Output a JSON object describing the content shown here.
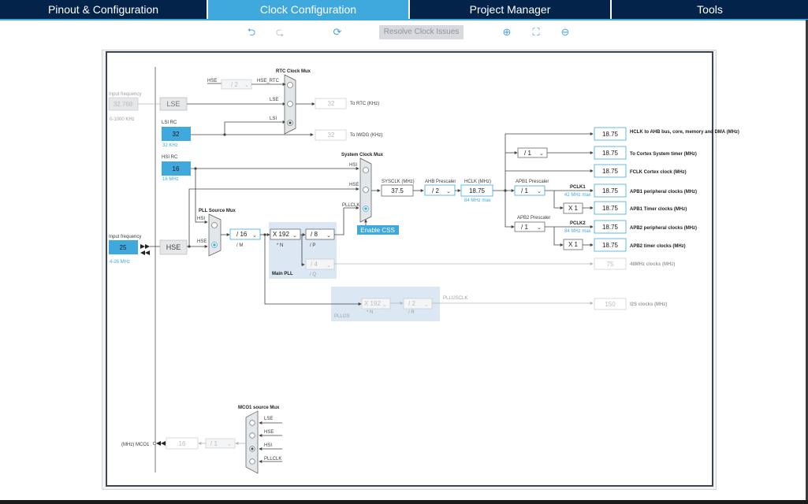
{
  "tabs": [
    {
      "label": "Pinout & Configuration",
      "active": false
    },
    {
      "label": "Clock Configuration",
      "active": true
    },
    {
      "label": "Project Manager",
      "active": false
    },
    {
      "label": "Tools",
      "active": false
    }
  ],
  "toolbar": {
    "undo_icon": "undo-icon",
    "redo_icon": "redo-icon",
    "reset_icon": "refresh-icon",
    "resolve_label": "Resolve Clock Issues",
    "zoom_in_icon": "zoom-in-icon",
    "fit_icon": "fit-screen-icon",
    "zoom_out_icon": "zoom-out-icon"
  },
  "colors": {
    "tab_bg": "#03234b",
    "tab_active": "#3fa9dd",
    "accent": "#3fa9dd"
  },
  "diagram": {
    "input_freq_lse_label": "Input frequency",
    "input_freq_lse": "32.768",
    "lse_range": "0-1000 KHz",
    "lse": "LSE",
    "lsi_rc": "LSI RC",
    "lsi_value": "32",
    "lsi_unit": "32 KHz",
    "hsi_rc": "HSI RC",
    "hsi_value": "16",
    "hsi_unit": "16 MHz",
    "input_freq_hse_label": "Input frequency",
    "input_freq_hse": "25",
    "hse_range": "4-26 MHz",
    "hse": "HSE",
    "rtc_mux_title": "RTC Clock Mux",
    "rtc_hse": "HSE",
    "rtc_div": "/ 2",
    "rtc_hse_rtc": "HSE_RTC",
    "rtc_lse": "LSE",
    "rtc_lsi": "LSI",
    "rtc_out": "32",
    "rtc_out_label": "To RTC (KHz)",
    "iwdg_out": "32",
    "iwdg_out_label": "To IWDG (KHz)",
    "sys_mux_title": "System Clock Mux",
    "sys_hsi": "HSI",
    "sys_hse": "HSE",
    "sys_pllclk": "PLLCLK",
    "enable_css": "Enable CSS",
    "sysclk_label": "SYSCLK (MHz)",
    "sysclk_value": "37.5",
    "ahb_label": "AHB Prescaler",
    "ahb_value": "/ 2",
    "hclk_label": "HCLK (MHz)",
    "hclk_value": "18.75",
    "hclk_max": "84 MHz max",
    "apb1_label": "APB1 Prescaler",
    "apb1_value": "/ 1",
    "pclk1": "PCLK1",
    "pclk1_max": "42 MHz max",
    "apb2_label": "APB2 Prescaler",
    "apb2_value": "/ 1",
    "pclk2": "PCLK2",
    "pclk2_max": "84 MHz max",
    "x1_a": "X 1",
    "x1_b": "X 1",
    "cortex_div": "/ 1",
    "pll_src_title": "PLL Source Mux",
    "pll_hsi": "HSI",
    "pll_hse": "HSE",
    "pll_m": "/ 16",
    "pll_m_label": "/ M",
    "pll_n": "X 192",
    "pll_n_label": "* N",
    "pll_p": "/ 8",
    "pll_p_label": "/ P",
    "pll_q": "/ 4",
    "pll_q_label": "/ Q",
    "main_pll": "Main PLL",
    "plli2s_n": "X 192",
    "plli2s_n_label": "* N",
    "plli2s_r": "/ 2",
    "plli2s_r_label": "/ R",
    "plli2s": "PLLI2S",
    "plli2sclk": "PLLI2SCLK",
    "outputs": [
      {
        "value": "18.75",
        "label": "HCLK to AHB bus, core, memory and DMA (MHz)"
      },
      {
        "value": "18.75",
        "label": "To Cortex System timer (MHz)"
      },
      {
        "value": "18.75",
        "label": "FCLK Cortex clock (MHz)"
      },
      {
        "value": "18.75",
        "label": "APB1 peripheral clocks (MHz)"
      },
      {
        "value": "18.75",
        "label": "APB1 Timer clocks (MHz)"
      },
      {
        "value": "18.75",
        "label": "APB2 peripheral clocks (MHz)"
      },
      {
        "value": "18.75",
        "label": "APB2 timer clocks (MHz)"
      }
    ],
    "mhz48_value": "75",
    "mhz48_label": "48MHz clocks (MHz)",
    "i2s_value": "150",
    "i2s_label": "I2S clocks (MHz)",
    "mco1_title": "MCO1 source Mux",
    "mco1_lse": "LSE",
    "mco1_hse": "HSE",
    "mco1_hsi": "HSI",
    "mco1_pllclk": "PLLCLK",
    "mco1_div": "/ 1",
    "mco1_value": "16",
    "mco1_label": "(MHz) MCO1"
  }
}
